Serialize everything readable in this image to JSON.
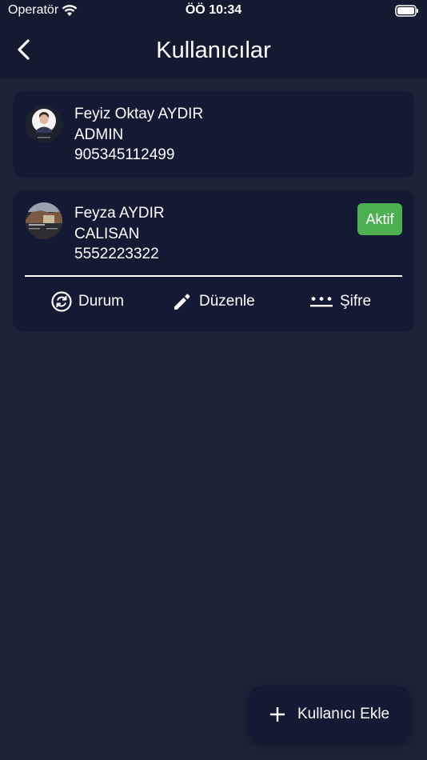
{
  "status_bar": {
    "carrier": "Operatör",
    "time": "ÖÖ 10:34",
    "wifi_icon": "wifi-icon",
    "battery_icon": "battery-icon"
  },
  "header": {
    "title": "Kullanıcılar",
    "back_icon": "chevron-left-icon"
  },
  "users": [
    {
      "name": "Feyiz Oktay AYDIR",
      "role": "ADMIN",
      "phone": "905345112499"
    },
    {
      "name": "Feyza AYDIR",
      "role": "CALISAN",
      "phone": "5552223322",
      "status": "Aktif",
      "status_color": "#4caf50"
    }
  ],
  "actions": {
    "status_label": "Durum",
    "edit_label": "Düzenle",
    "password_label": "Şifre"
  },
  "fab": {
    "label": "Kullanıcı Ekle",
    "icon": "plus-icon"
  },
  "colors": {
    "background": "#1b2337",
    "header": "#141a30",
    "card": "#141a34",
    "accent": "#4caf50"
  }
}
